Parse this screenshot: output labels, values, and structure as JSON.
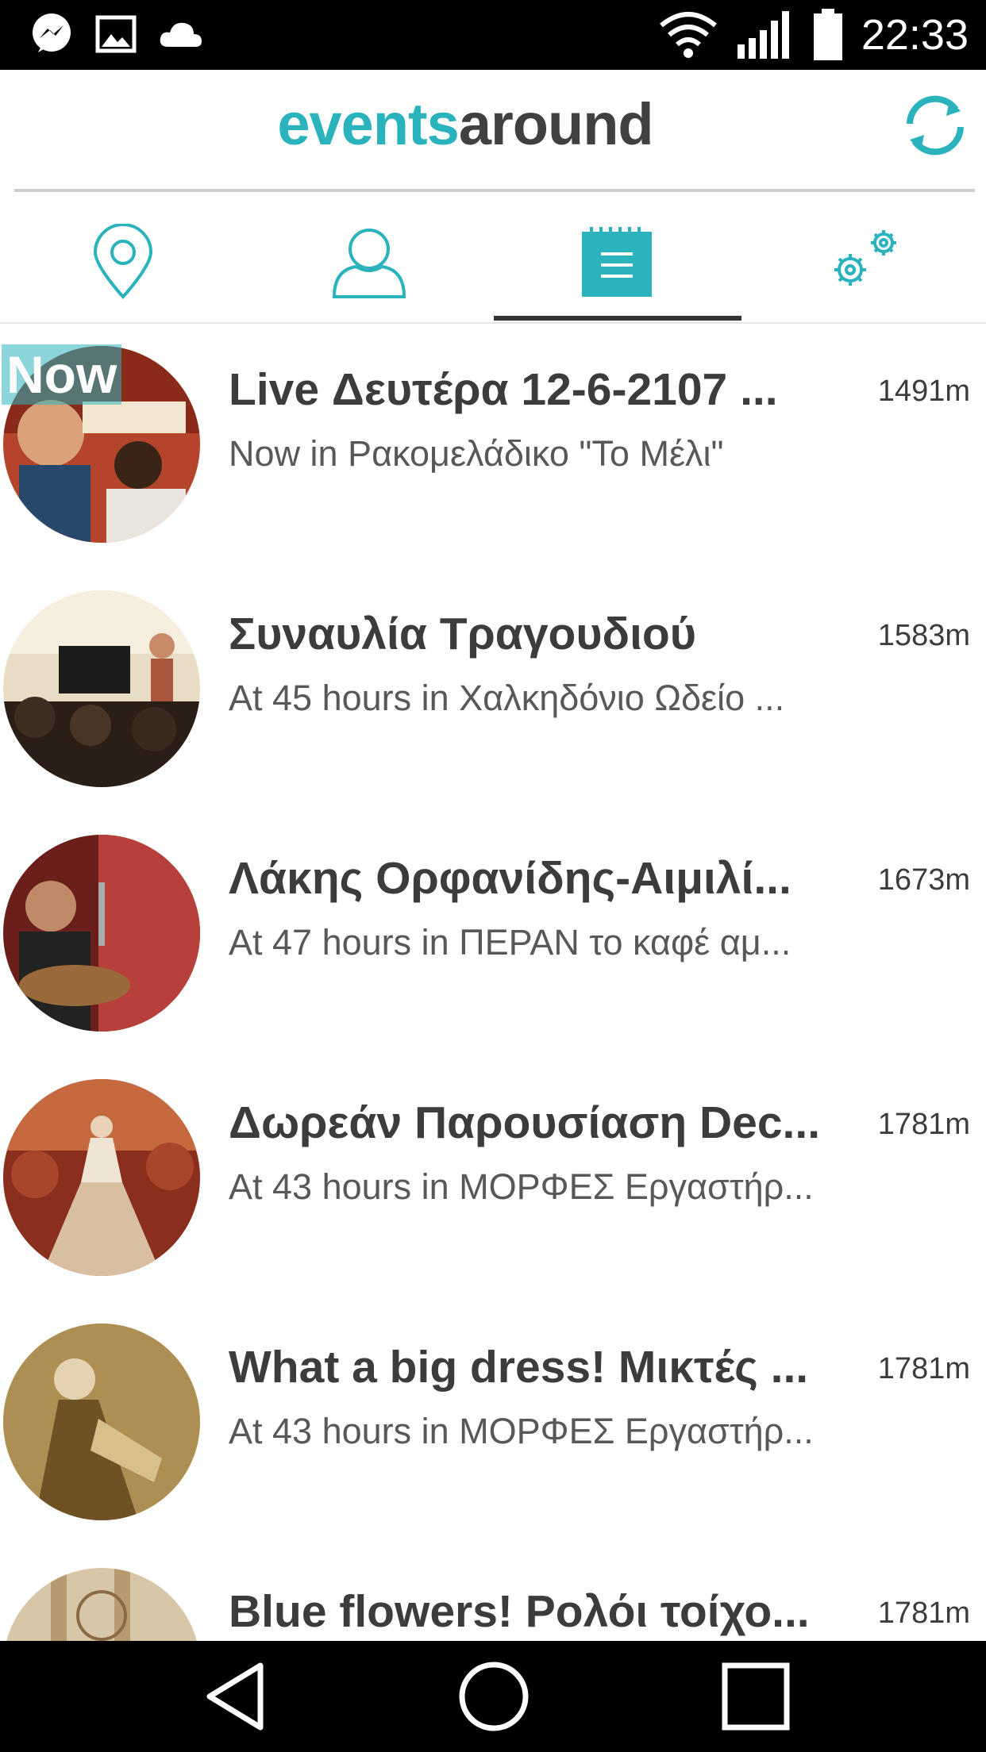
{
  "status_bar": {
    "time": "22:33",
    "left_icons": [
      "messenger-icon",
      "image-icon",
      "cloud-icon"
    ],
    "right_icons": [
      "wifi-icon",
      "signal-icon",
      "battery-icon"
    ]
  },
  "app_bar": {
    "logo_part1": "events",
    "logo_part2": "around",
    "refresh_icon": "refresh-icon"
  },
  "tabs": [
    {
      "icon": "map-pin-icon",
      "selected": false
    },
    {
      "icon": "profile-icon",
      "selected": false
    },
    {
      "icon": "list-icon",
      "selected": true
    },
    {
      "icon": "settings-gears-icon",
      "selected": false
    }
  ],
  "events": [
    {
      "badge": "Now",
      "title": "Live Δευτέρα 12-6-2107 ...",
      "subtitle": "Now in Ρακομελάδικο \"Το Μέλι\"",
      "distance": "1491m"
    },
    {
      "badge": "",
      "title": "Συναυλία Τραγουδιού",
      "subtitle": "At 45 hours in Χαλκηδόνιο Ωδείο ...",
      "distance": "1583m"
    },
    {
      "badge": "",
      "title": "Λάκης Ορφανίδης-Αιμιλί...",
      "subtitle": "At 47 hours in ΠΕΡΑΝ το καφέ αμ...",
      "distance": "1673m"
    },
    {
      "badge": "",
      "title": "Δωρεάν Παρουσίαση Dec...",
      "subtitle": "At 43 hours in ΜΟΡΦΕΣ Εργαστήρ...",
      "distance": "1781m"
    },
    {
      "badge": "",
      "title": "What a big dress! Μικτές ...",
      "subtitle": "At 43 hours in ΜΟΡΦΕΣ Εργαστήρ...",
      "distance": "1781m"
    },
    {
      "badge": "",
      "title": "Blue flowers! Ρολόι τοίχο...",
      "subtitle": "",
      "distance": "1781m"
    }
  ],
  "nav_bar": [
    "back-icon",
    "home-icon",
    "recents-icon"
  ],
  "colors": {
    "accent": "#2bb3bd",
    "text_dark": "#3c3c3c",
    "text_secondary": "#585858"
  }
}
